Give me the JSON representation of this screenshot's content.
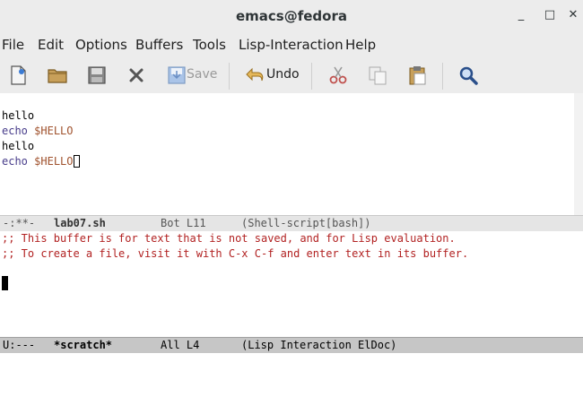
{
  "window": {
    "title": "emacs@fedora",
    "minimize": "_",
    "maximize": "□",
    "close": "✕"
  },
  "menubar": {
    "items": [
      "File",
      "Edit",
      "Options",
      "Buffers",
      "Tools",
      "Lisp-Interaction",
      "Help"
    ]
  },
  "toolbar": {
    "save_label": "Save",
    "undo_label": "Undo"
  },
  "buffer1": {
    "lines": [
      {
        "type": "plain",
        "text": "hello"
      },
      {
        "type": "echo",
        "cmd": "echo",
        "arg": "$HELLO"
      },
      {
        "type": "plain",
        "text": "hello"
      },
      {
        "type": "echo",
        "cmd": "echo",
        "arg": "$HELLO"
      }
    ]
  },
  "modeline1": {
    "status": "-:**-",
    "buffer": "lab07.sh",
    "position": "Bot L11",
    "mode": "(Shell-script[bash])"
  },
  "buffer2": {
    "lines": [
      ";; This buffer is for text that is not saved, and for Lisp evaluation.",
      ";; To create a file, visit it with C-x C-f and enter text in its buffer."
    ]
  },
  "modeline2": {
    "status": "U:---",
    "buffer": "*scratch*",
    "position": "All L4",
    "mode": "(Lisp Interaction ElDoc)"
  },
  "colors": {
    "keyword": "#483d8b",
    "variable": "#a0522d",
    "comment": "#b22222"
  }
}
